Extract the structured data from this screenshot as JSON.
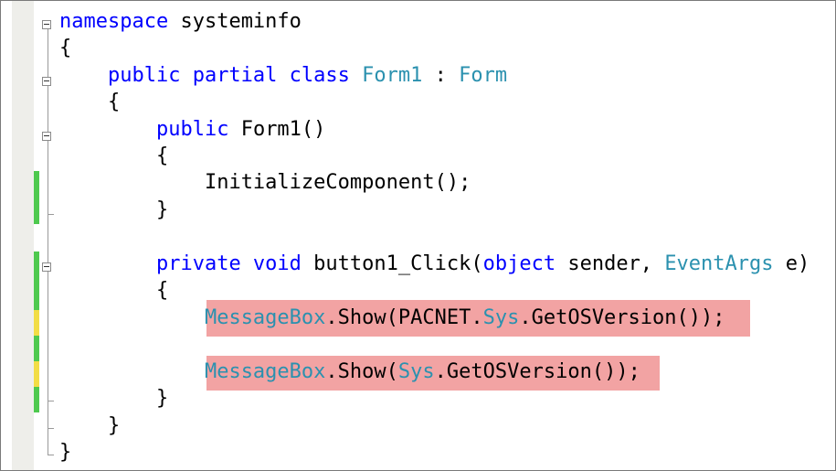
{
  "colors": {
    "keyword": "#0000ff",
    "type": "#2b91af",
    "plain": "#000000",
    "error_highlight": "#f2a3a3",
    "change_saved": "#4ec94e",
    "change_unsaved": "#f2dd45",
    "margin": "#eeeeea"
  },
  "code": {
    "l1": {
      "kw1": "namespace",
      "name": " systeminfo"
    },
    "l2": {
      "text": "{"
    },
    "l3": {
      "indent": "    ",
      "kw1": "public partial class",
      "sp1": " ",
      "type1": "Form1",
      "sep": " : ",
      "type2": "Form"
    },
    "l4": {
      "indent": "    ",
      "text": "{"
    },
    "l5": {
      "indent": "        ",
      "kw1": "public",
      "rest": " Form1()"
    },
    "l6": {
      "indent": "        ",
      "text": "{"
    },
    "l7": {
      "indent": "            ",
      "text": "InitializeComponent();"
    },
    "l8": {
      "indent": "        ",
      "text": "}"
    },
    "l10": {
      "indent": "        ",
      "kw1": "private void",
      "mid1": " button1_Click(",
      "kw2": "object",
      "mid2": " sender, ",
      "type1": "EventArgs",
      "rest": " e)"
    },
    "l11": {
      "indent": "        ",
      "text": "{"
    },
    "l12": {
      "indent": "            ",
      "type1": "MessageBox",
      "mid1": ".Show(PACNET.",
      "type2": "Sys",
      "rest": ".GetOSVersion());"
    },
    "l14": {
      "indent": "            ",
      "type1": "MessageBox",
      "mid1": ".Show(",
      "type2": "Sys",
      "rest": ".GetOSVersion());"
    },
    "l15": {
      "indent": "        ",
      "text": "}"
    },
    "l16": {
      "indent": "    ",
      "text": "}"
    },
    "l17": {
      "text": "}"
    }
  }
}
